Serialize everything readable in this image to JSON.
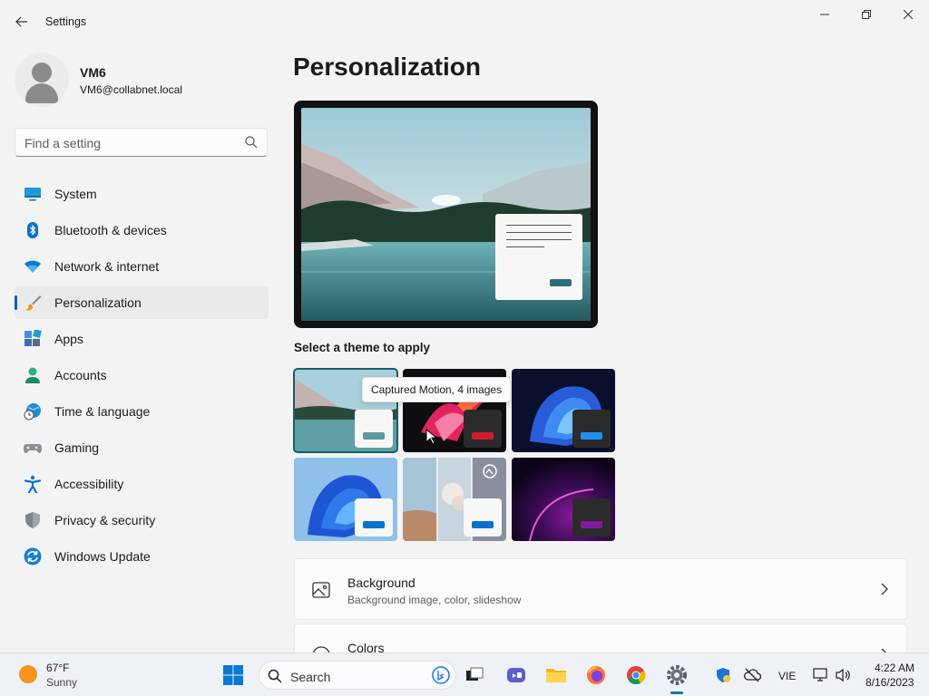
{
  "app": {
    "title": "Settings"
  },
  "user": {
    "name": "VM6",
    "email": "VM6@collabnet.local"
  },
  "search": {
    "placeholder": "Find a setting"
  },
  "nav": [
    {
      "label": "System",
      "icon": "system-icon"
    },
    {
      "label": "Bluetooth & devices",
      "icon": "bluetooth-icon"
    },
    {
      "label": "Network & internet",
      "icon": "wifi-icon"
    },
    {
      "label": "Personalization",
      "icon": "brush-icon",
      "active": true
    },
    {
      "label": "Apps",
      "icon": "apps-icon"
    },
    {
      "label": "Accounts",
      "icon": "accounts-icon"
    },
    {
      "label": "Time & language",
      "icon": "globe-clock-icon"
    },
    {
      "label": "Gaming",
      "icon": "gamepad-icon"
    },
    {
      "label": "Accessibility",
      "icon": "accessibility-icon"
    },
    {
      "label": "Privacy & security",
      "icon": "shield-icon"
    },
    {
      "label": "Windows Update",
      "icon": "update-icon"
    }
  ],
  "main": {
    "title": "Personalization",
    "themes_label": "Select a theme to apply",
    "tooltip": "Captured Motion, 4 images",
    "themes": [
      {
        "name": "lake-theme",
        "selected": true
      },
      {
        "name": "captured-motion-theme",
        "selected": false
      },
      {
        "name": "windows-dark-theme",
        "selected": false
      },
      {
        "name": "windows-light-theme",
        "selected": false
      },
      {
        "name": "spotlight-theme",
        "selected": false
      },
      {
        "name": "glow-theme",
        "selected": false
      }
    ],
    "cards": [
      {
        "title": "Background",
        "subtitle": "Background image, color, slideshow",
        "icon": "image-icon"
      },
      {
        "title": "Colors",
        "subtitle": "",
        "icon": "palette-icon"
      }
    ]
  },
  "taskbar": {
    "weather_temp": "67°F",
    "weather_condition": "Sunny",
    "search_label": "Search",
    "language": "VIE",
    "time": "4:22 AM",
    "date": "8/16/2023"
  },
  "colors": {
    "accent": "#005fb8",
    "selected_theme_border": "#1a5e6a"
  }
}
